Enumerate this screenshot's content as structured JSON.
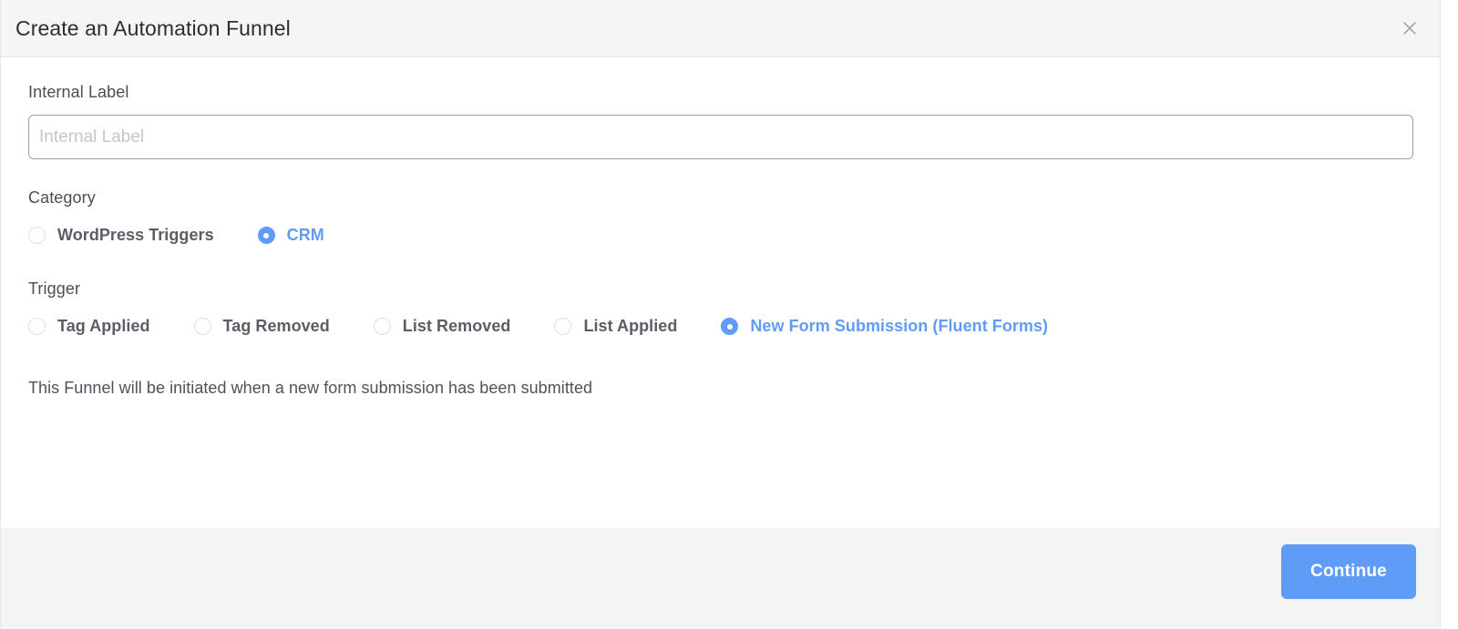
{
  "dialog": {
    "title": "Create an Automation Funnel",
    "close_icon": "close-icon"
  },
  "internal_label": {
    "label": "Internal Label",
    "value": "",
    "placeholder": "Internal Label"
  },
  "category": {
    "heading": "Category",
    "selected": "CRM",
    "options": [
      {
        "label": "WordPress Triggers",
        "selected": false
      },
      {
        "label": "CRM",
        "selected": true
      }
    ]
  },
  "trigger": {
    "heading": "Trigger",
    "selected": "New Form Submission (Fluent Forms)",
    "options": [
      {
        "label": "Tag Applied",
        "selected": false
      },
      {
        "label": "Tag Removed",
        "selected": false
      },
      {
        "label": "List Removed",
        "selected": false
      },
      {
        "label": "List Applied",
        "selected": false
      },
      {
        "label": "New Form Submission (Fluent Forms)",
        "selected": true
      }
    ]
  },
  "helper_text": "This Funnel will be initiated when a new form submission has been submitted",
  "footer": {
    "continue_label": "Continue"
  },
  "colors": {
    "accent": "#5f9cf7",
    "header_bg": "#f5f5f5",
    "footer_bg": "#f4f4f4",
    "label_text": "#4a4e55",
    "radio_text": "#5a5e66",
    "border": "#dcdfe6"
  }
}
